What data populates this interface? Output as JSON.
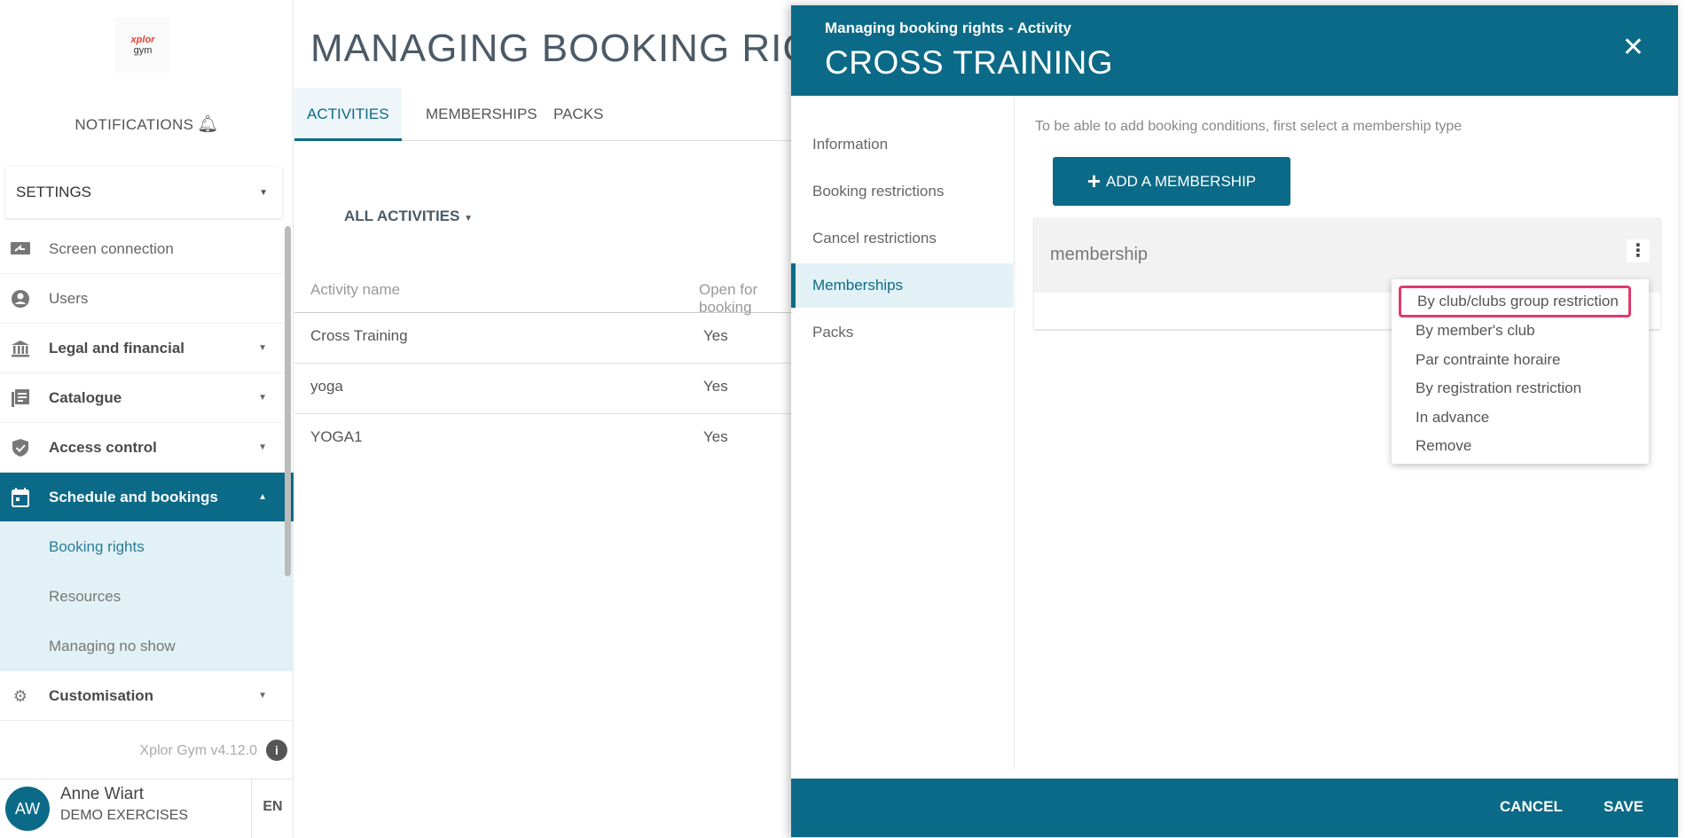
{
  "sidebar": {
    "logo": {
      "line1": "xplor",
      "line2": "gym"
    },
    "notifications_label": "NOTIFICATIONS",
    "settings_label": "SETTINGS",
    "items": [
      {
        "label": "Screen connection",
        "icon": "screen-icon"
      },
      {
        "label": "Users",
        "icon": "user-icon"
      },
      {
        "label": "Legal and financial",
        "icon": "bank-icon"
      },
      {
        "label": "Catalogue",
        "icon": "catalogue-icon"
      },
      {
        "label": "Access control",
        "icon": "shield-icon"
      },
      {
        "label": "Schedule and bookings",
        "icon": "calendar-icon"
      },
      {
        "label": "Booking rights"
      },
      {
        "label": "Resources"
      },
      {
        "label": "Managing no show"
      },
      {
        "label": "Customisation",
        "icon": "gear-icon"
      }
    ],
    "version": "Xplor Gym v4.12.0",
    "user": {
      "initials": "AW",
      "name": "Anne Wiart",
      "club": "DEMO EXERCISES"
    },
    "language": "EN"
  },
  "main": {
    "title": "MANAGING BOOKING RIGHTS",
    "tabs": [
      "ACTIVITIES",
      "MEMBERSHIPS",
      "PACKS"
    ],
    "filter_label": "ALL ACTIVITIES",
    "table": {
      "headers": [
        "Activity name",
        "Open for booking"
      ],
      "rows": [
        {
          "name": "Cross Training",
          "open": "Yes"
        },
        {
          "name": "yoga",
          "open": "Yes"
        },
        {
          "name": "YOGA1",
          "open": "Yes"
        }
      ]
    }
  },
  "panel": {
    "subtitle": "Managing booking rights - Activity",
    "title": "CROSS TRAINING",
    "close_glyph": "✕",
    "nav": [
      "Information",
      "Booking restrictions",
      "Cancel restrictions",
      "Memberships",
      "Packs"
    ],
    "hint": "To be able to add booking conditions, first select a membership type",
    "add_button": "ADD A MEMBERSHIP",
    "membership_label": "membership",
    "dropdown": [
      "By club/clubs group restriction",
      "By member's club",
      "Par contrainte horaire",
      "By registration restriction",
      "In advance",
      "Remove"
    ],
    "cancel_label": "CANCEL",
    "save_label": "SAVE"
  },
  "colors": {
    "primary": "#0b6a87",
    "highlight": "#e03a6c",
    "selected_bg": "#e1f1f5"
  }
}
